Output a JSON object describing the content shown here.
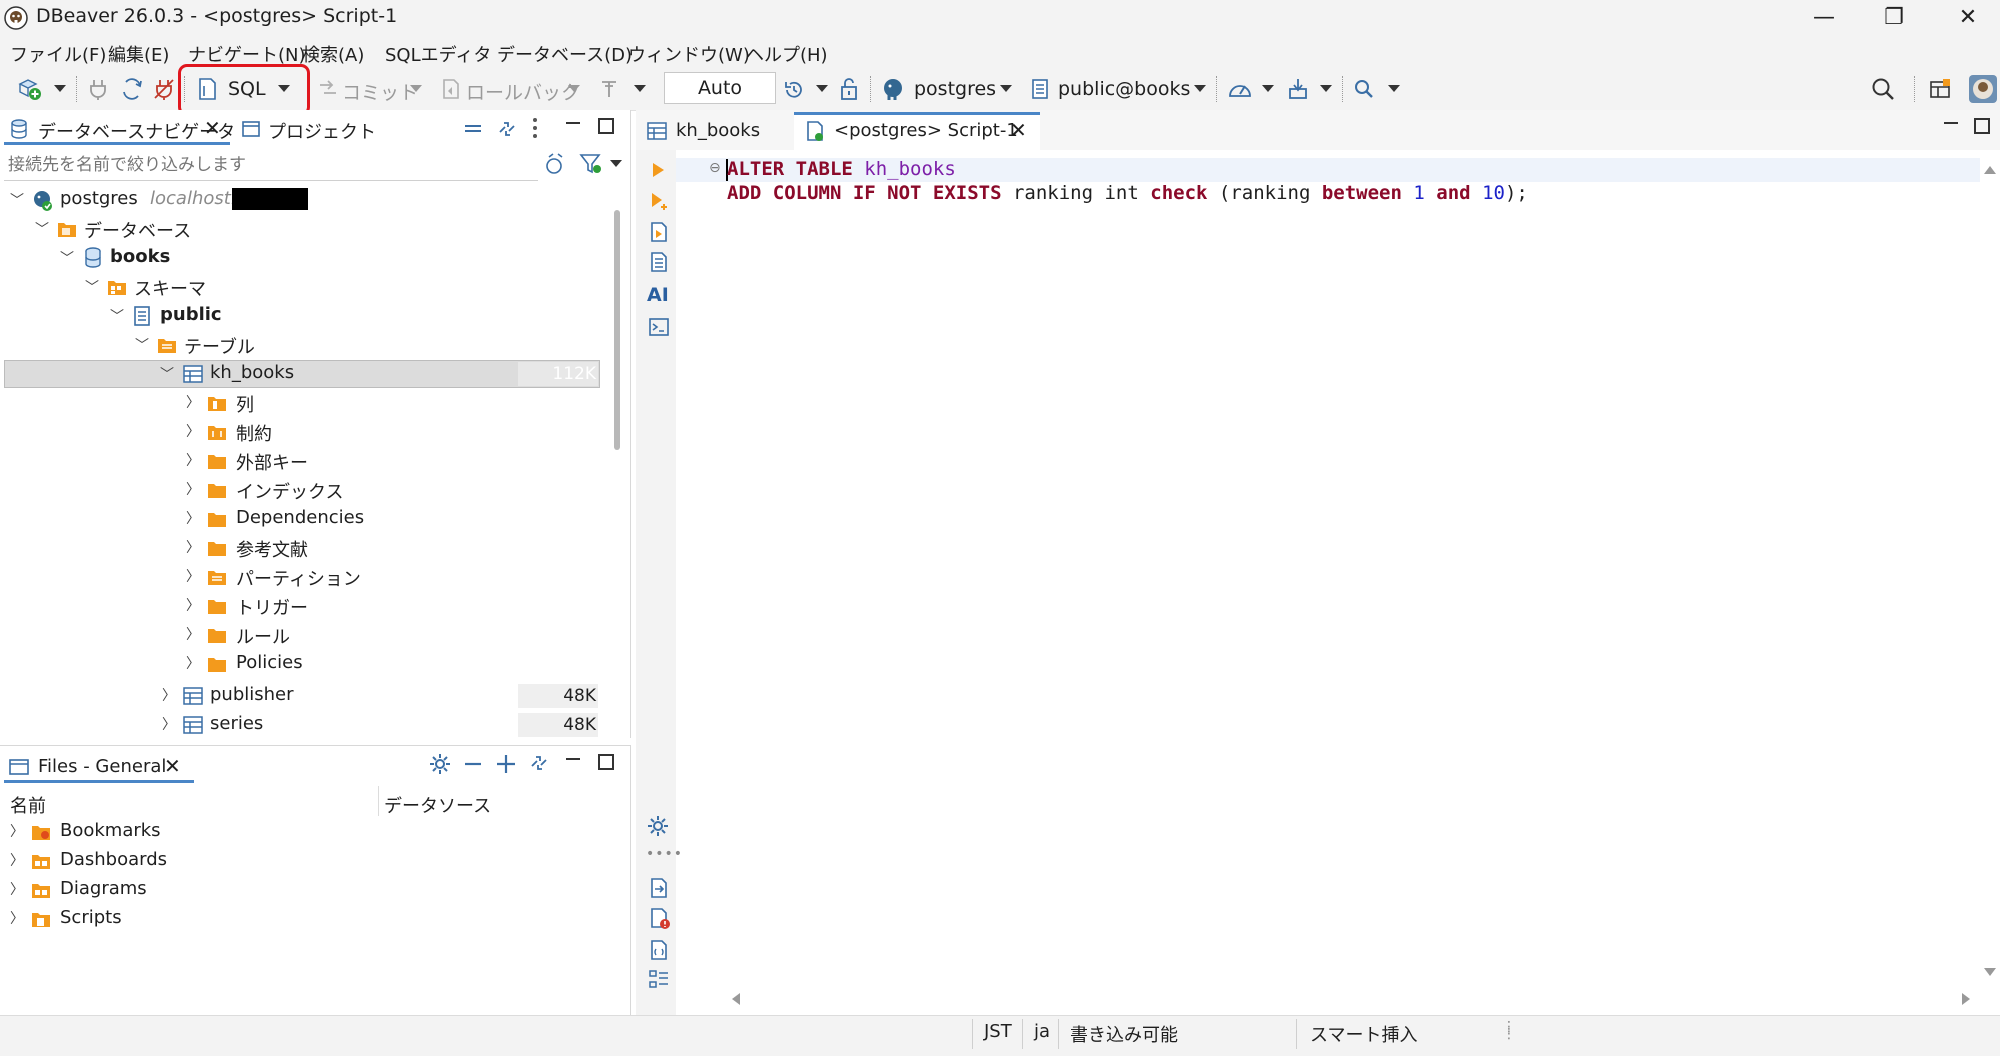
{
  "window": {
    "title": "DBeaver 26.0.3 - <postgres> Script-1",
    "minimize": "—",
    "maximize": "❐",
    "close": "✕"
  },
  "menu": [
    "ファイル(F)",
    "編集(E)",
    "ナビゲート(N)",
    "検索(A)",
    "SQLエディタ",
    "データベース(D)",
    "ウィンドウ(W)",
    "ヘルプ(H)"
  ],
  "toolbar": {
    "sql_label": "SQL",
    "commit_label": "コミット",
    "rollback_label": "ロールバック",
    "transaction_mode": "Auto",
    "datasource": "postgres",
    "schema": "public@books"
  },
  "navigator": {
    "tab_label": "データベースナビゲータ",
    "project_tab_label": "プロジェクト",
    "filter_placeholder": "接続先を名前で絞り込みします",
    "tree": {
      "connection": "postgres",
      "connection_host": "localhost:",
      "databases_folder": "データベース",
      "database": "books",
      "schemas_folder": "スキーマ",
      "schema": "public",
      "tables_folder": "テーブル",
      "selected_table": "kh_books",
      "selected_table_size": "112K",
      "table_children": [
        "列",
        "制約",
        "外部キー",
        "インデックス",
        "Dependencies",
        "参考文献",
        "パーティション",
        "トリガー",
        "ルール",
        "Policies"
      ],
      "other_tables": [
        {
          "name": "publisher",
          "size": "48K"
        },
        {
          "name": "series",
          "size": "48K"
        }
      ]
    }
  },
  "files_panel": {
    "tab_label": "Files - General",
    "columns": [
      "名前",
      "データソース"
    ],
    "items": [
      "Bookmarks",
      "Dashboards",
      "Diagrams",
      "Scripts"
    ]
  },
  "editor": {
    "tabs": [
      "kh_books",
      "<postgres> Script-1"
    ],
    "code": {
      "line1": {
        "kw": "ALTER TABLE",
        "table": "kh_books"
      },
      "line2": {
        "kw1": "ADD COLUMN IF NOT EXISTS",
        "col": " ranking int ",
        "kw2": "check",
        "cond": " (ranking ",
        "kw3": "between",
        "n1": "1",
        "kw4": "and",
        "n2": "10",
        "end": ");"
      }
    }
  },
  "statusbar": {
    "timezone": "JST",
    "locale": "ja",
    "mode": "書き込み可能",
    "insert_mode": "スマート挿入"
  },
  "colors": {
    "keyword": "#8b0a2a",
    "identifier": "#7d1fa8",
    "number": "#1c22c9",
    "highlight": "#e0161e",
    "folder": "#f39a1c"
  }
}
